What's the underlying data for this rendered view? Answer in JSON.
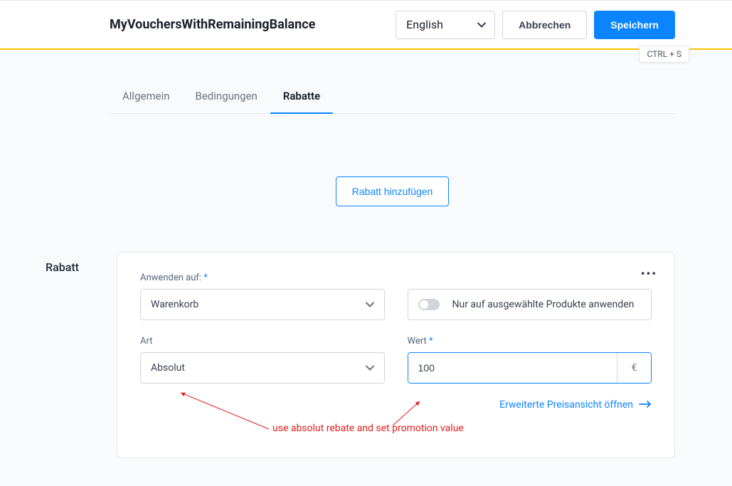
{
  "header": {
    "title": "MyVouchersWithRemainingBalance",
    "language": "English",
    "cancel_label": "Abbrechen",
    "save_label": "Speichern",
    "shortcut": "CTRL + S"
  },
  "tabs": {
    "general": "Allgemein",
    "conditions": "Bedingungen",
    "discounts": "Rabatte"
  },
  "add_discount_button": "Rabatt hinzufügen",
  "section": {
    "title": "Rabatt"
  },
  "form": {
    "apply_to_label": "Anwenden auf:",
    "apply_to_value": "Warenkorb",
    "only_selected_products": "Nur auf ausgewählte Produkte anwenden",
    "type_label": "Art",
    "type_value": "Absolut",
    "value_label": "Wert",
    "value_value": "100",
    "currency": "€",
    "advanced_link": "Erweiterte Preisansicht öffnen"
  },
  "annotation": {
    "text": "use absolut rebate and set promotion value"
  }
}
